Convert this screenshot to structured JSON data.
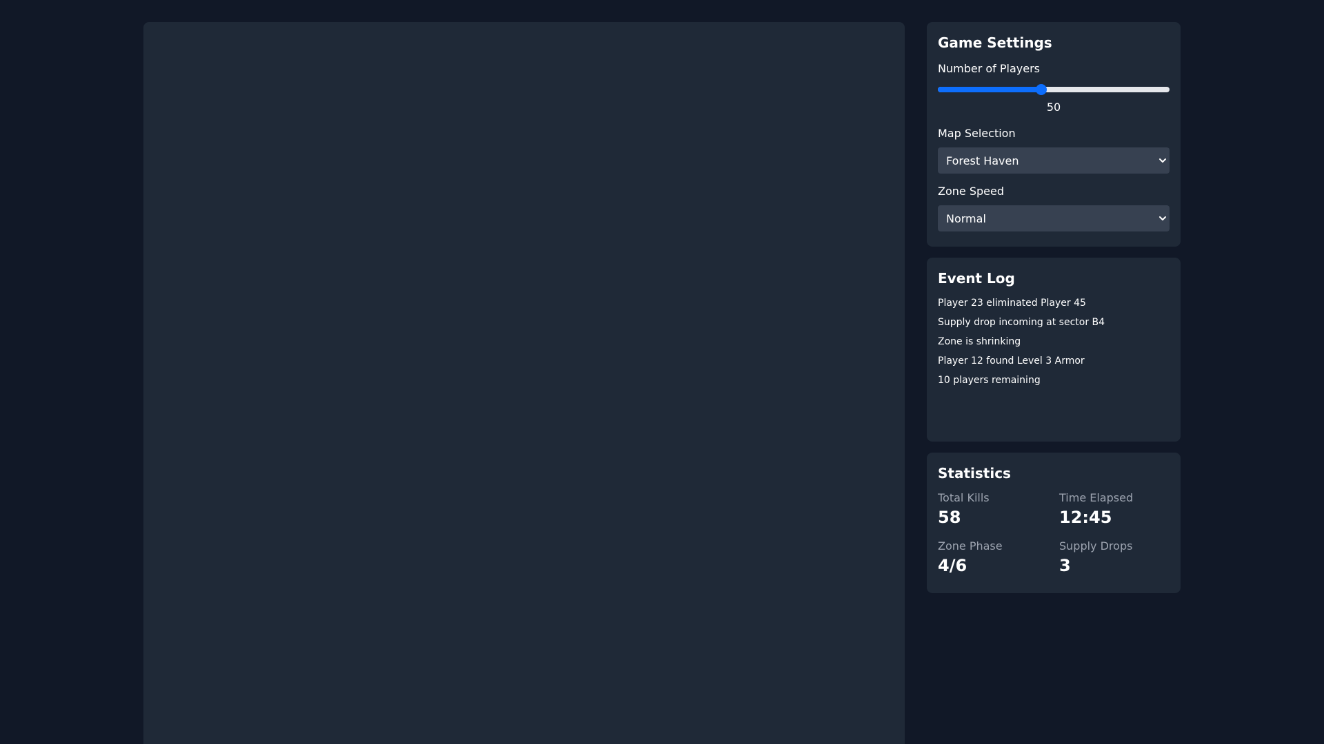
{
  "settings": {
    "title": "Game Settings",
    "players_label": "Number of Players",
    "players_value": "50",
    "players_fraction": 0.447,
    "map_label": "Map Selection",
    "map_selected": "Forest Haven",
    "speed_label": "Zone Speed",
    "speed_selected": "Normal"
  },
  "event_log": {
    "title": "Event Log",
    "entries": [
      "Player 23 eliminated Player 45",
      "Supply drop incoming at sector B4",
      "Zone is shrinking",
      "Player 12 found Level 3 Armor",
      "10 players remaining"
    ]
  },
  "stats": {
    "title": "Statistics",
    "items": [
      {
        "label": "Total Kills",
        "value": "58"
      },
      {
        "label": "Time Elapsed",
        "value": "12:45"
      },
      {
        "label": "Zone Phase",
        "value": "4/6"
      },
      {
        "label": "Supply Drops",
        "value": "3"
      }
    ]
  },
  "colors": {
    "page_bg": "#111827",
    "panel_bg": "#1f2937",
    "accent": "#0d6efd",
    "input_bg": "#374151",
    "muted_text": "#9ca3af"
  },
  "icons": {
    "select_arrow": "chevron-down-icon"
  }
}
